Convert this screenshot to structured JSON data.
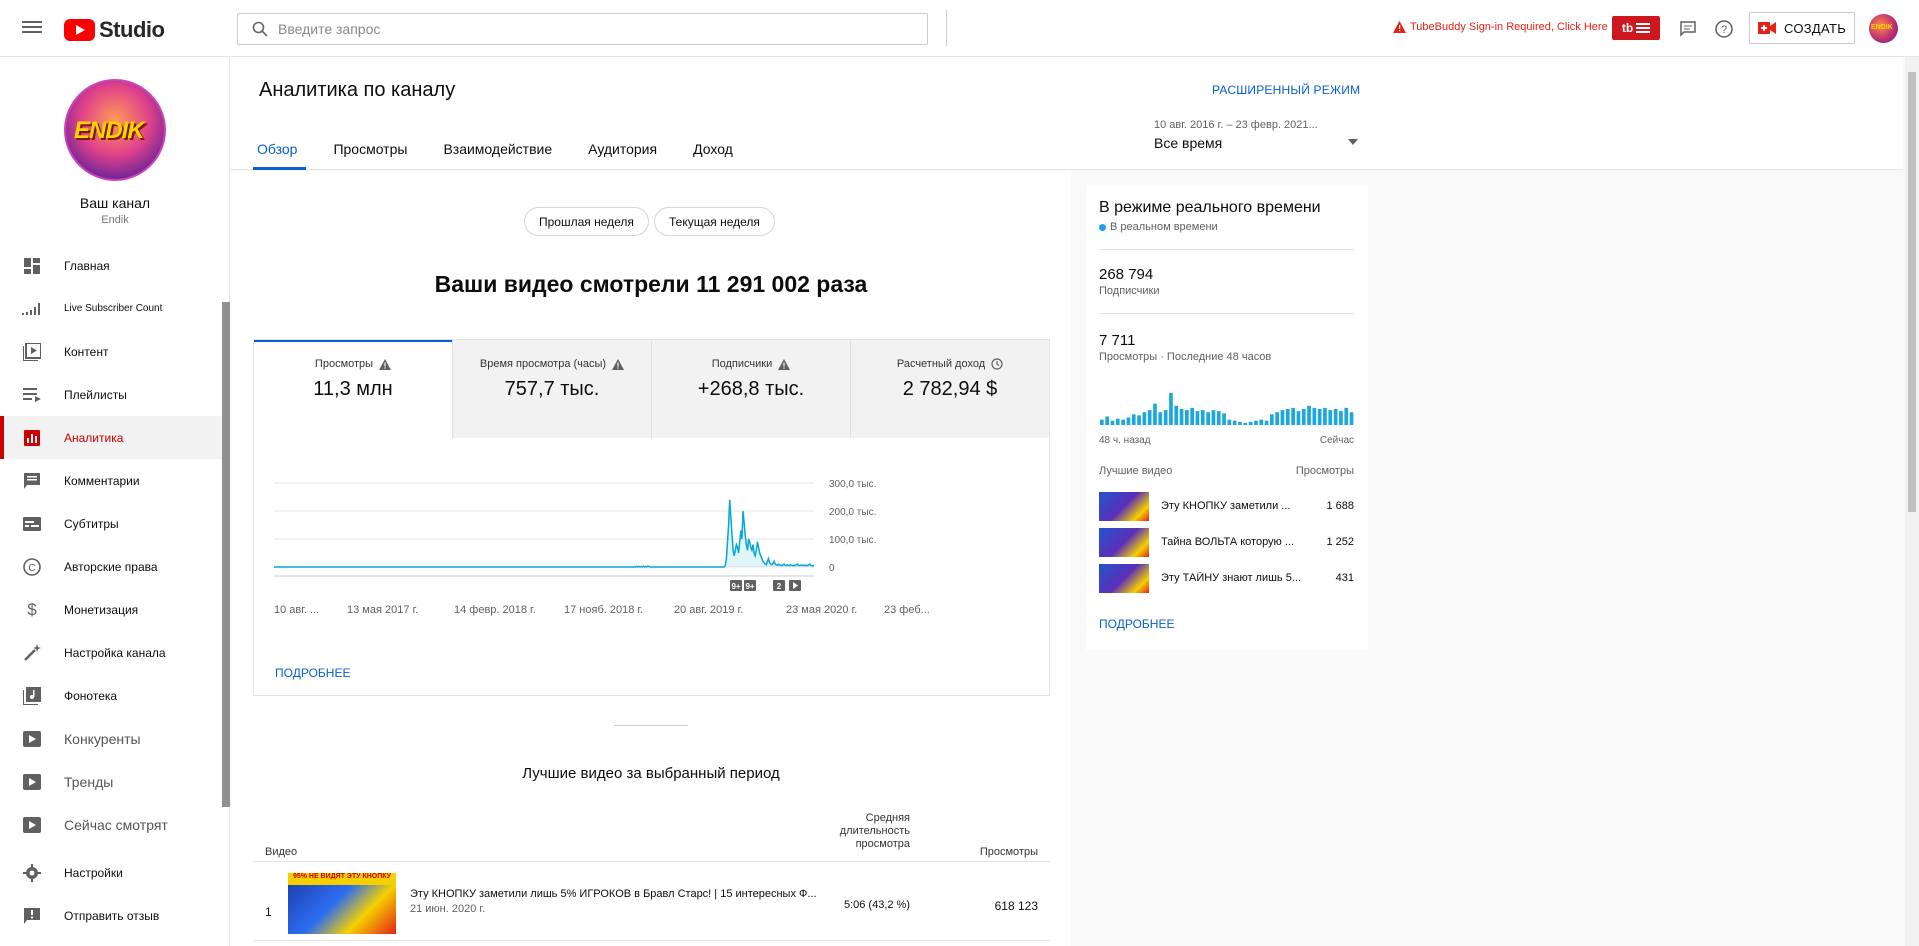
{
  "topbar": {
    "logo_text": "Studio",
    "search_placeholder": "Введите запрос",
    "tubebuddy_warning": "TubeBuddy Sign-in Required, Click Here",
    "tubebuddy_logo": "tb",
    "create_label": "СОЗДАТЬ"
  },
  "sidebar": {
    "channel_title": "Ваш канал",
    "channel_name": "Endik",
    "avatar_text": "ENDIK",
    "items": [
      {
        "label": "Главная",
        "icon": "dashboard-icon"
      },
      {
        "label": "Live Subscriber Count",
        "icon": "bar-signal-icon"
      },
      {
        "label": "Контент",
        "icon": "video-library-icon"
      },
      {
        "label": "Плейлисты",
        "icon": "playlist-icon"
      },
      {
        "label": "Аналитика",
        "icon": "analytics-icon"
      },
      {
        "label": "Комментарии",
        "icon": "comment-icon"
      },
      {
        "label": "Субтитры",
        "icon": "subtitles-icon"
      },
      {
        "label": "Авторские права",
        "icon": "copyright-icon"
      },
      {
        "label": "Монетизация",
        "icon": "dollar-icon"
      },
      {
        "label": "Настройка канала",
        "icon": "magic-wand-icon"
      },
      {
        "label": "Фонотека",
        "icon": "audio-library-icon"
      },
      {
        "label": "Конкуренты",
        "icon": "tubebuddy-play-icon"
      },
      {
        "label": "Тренды",
        "icon": "tubebuddy-play-icon"
      },
      {
        "label": "Сейчас смотрят",
        "icon": "tubebuddy-play-icon"
      },
      {
        "label": "Настройки",
        "icon": "gear-icon"
      },
      {
        "label": "Отправить отзыв",
        "icon": "feedback-icon"
      }
    ]
  },
  "header": {
    "title": "Аналитика по каналу",
    "advanced_mode": "РАСШИРЕННЫЙ РЕЖИМ",
    "tabs": [
      "Обзор",
      "Просмотры",
      "Взаимодействие",
      "Аудитория",
      "Доход"
    ],
    "active_tab": "Обзор",
    "period_range": "10 авг. 2016 г. – 23 февр. 2021...",
    "period_value": "Все время"
  },
  "overview": {
    "chips": [
      "Прошлая неделя",
      "Текущая неделя"
    ],
    "headline": "Ваши видео смотрели 11 291 002 раза",
    "metrics": [
      {
        "label": "Просмотры",
        "value": "11,3 млн",
        "icon": "warning-icon"
      },
      {
        "label": "Время просмотра (часы)",
        "value": "757,7 тыс.",
        "icon": "warning-icon"
      },
      {
        "label": "Подписчики",
        "value": "+268,8 тыс.",
        "icon": "warning-icon"
      },
      {
        "label": "Расчетный доход",
        "value": "2 782,94 $",
        "icon": "clock-icon"
      }
    ],
    "more_label": "ПОДРОБНЕЕ"
  },
  "chart_data": {
    "type": "line",
    "x_tick_labels": [
      "10 авг. ...",
      "13 мая 2017 г.",
      "14 февр. 2018 г.",
      "17 нояб. 2018 г.",
      "20 авг. 2019 г.",
      "23 мая 2020 г.",
      "23 феб..."
    ],
    "y_tick_labels": [
      "300,0 тыс.",
      "200,0 тыс.",
      "100,0 тыс.",
      "0"
    ],
    "ylim": [
      0,
      300000
    ],
    "series": [
      {
        "values": [
          0,
          0,
          0,
          0,
          0,
          0,
          0,
          0,
          0,
          0,
          0,
          0,
          0,
          0,
          0,
          0,
          0,
          0,
          0,
          0,
          0,
          0,
          0,
          0,
          0,
          0,
          0,
          0,
          0,
          0,
          0,
          0,
          0,
          0,
          0,
          0,
          0,
          0,
          0,
          0,
          0,
          0,
          0,
          0,
          0,
          0,
          0,
          0,
          0,
          0,
          0,
          0,
          0,
          0,
          0,
          0,
          0,
          0,
          0,
          0,
          0,
          0,
          0,
          0,
          0,
          0,
          0,
          0,
          0,
          0,
          0,
          0,
          0,
          0,
          0,
          0,
          0,
          0,
          0,
          0,
          0,
          0,
          0,
          0,
          0,
          0,
          0,
          0,
          0,
          0,
          0,
          0,
          0,
          0,
          0,
          0,
          0,
          0,
          0,
          0,
          0,
          0,
          0,
          0,
          0,
          0,
          0,
          0,
          0,
          0,
          0,
          0,
          0,
          0,
          0,
          0,
          0,
          0,
          0,
          0,
          0,
          0,
          0,
          0,
          0,
          0,
          0,
          0,
          0,
          0,
          0,
          0,
          0,
          0,
          0,
          0,
          0,
          0,
          0,
          0,
          0,
          0,
          0,
          0,
          0,
          0,
          0,
          0,
          0,
          0,
          0,
          0,
          0,
          0,
          0,
          0,
          0,
          0,
          0,
          0,
          0,
          0,
          0,
          0,
          0,
          0,
          0,
          0,
          0,
          0,
          0,
          0,
          0,
          0,
          0,
          0,
          0,
          0,
          0,
          0,
          0,
          0,
          0,
          0,
          0,
          0,
          0,
          0,
          0,
          0,
          0,
          0,
          0,
          0,
          0,
          0,
          0,
          0,
          0,
          0,
          0,
          0,
          0,
          0,
          0,
          0,
          0,
          0,
          0,
          0,
          0,
          0,
          0,
          0,
          0,
          0,
          0,
          0,
          0,
          0,
          0,
          0,
          0,
          0,
          0,
          0,
          0,
          0,
          0,
          0,
          0,
          0,
          0,
          0,
          0,
          0,
          0,
          0,
          0,
          0,
          0,
          0,
          0,
          0,
          0,
          0,
          0,
          0,
          0,
          0,
          0,
          0,
          0,
          0,
          0,
          0,
          0,
          0,
          0,
          0,
          0,
          0,
          0,
          0,
          0,
          0,
          0,
          0,
          0,
          0,
          0,
          0,
          0,
          0,
          0,
          0,
          0,
          0,
          0,
          0,
          0,
          0,
          0,
          0,
          0,
          0,
          0,
          0,
          0,
          0,
          0,
          0,
          0,
          0,
          0,
          0,
          0,
          0,
          0,
          0,
          0,
          0,
          0,
          0,
          0,
          0,
          0,
          0,
          0,
          0,
          0,
          0,
          0,
          0,
          0,
          0,
          0,
          0,
          0,
          0,
          0,
          0,
          0,
          0,
          0,
          0,
          0,
          2000,
          0,
          2000,
          0,
          1000,
          0,
          3000,
          0,
          2000,
          0,
          3000,
          2000,
          0,
          0,
          0,
          0,
          0,
          0,
          0,
          0,
          0,
          0,
          0,
          0,
          0,
          0,
          0,
          0,
          0,
          0,
          0,
          0,
          0,
          0,
          0,
          0,
          0,
          0,
          0,
          0,
          0,
          0,
          0,
          0,
          0,
          0,
          0,
          0,
          0,
          0,
          0,
          0,
          0,
          0,
          0,
          0,
          0,
          0,
          0,
          0,
          0,
          0,
          0,
          0,
          0,
          0,
          0,
          0,
          0,
          0,
          0,
          0,
          0,
          0,
          0,
          0,
          0,
          0,
          0,
          0,
          5000,
          30000,
          90000,
          150000,
          240000,
          180000,
          120000,
          60000,
          40000,
          60000,
          80000,
          70000,
          50000,
          90000,
          130000,
          100000,
          200000,
          160000,
          110000,
          80000,
          60000,
          100000,
          90000,
          70000,
          60000,
          80000,
          50000,
          40000,
          60000,
          90000,
          70000,
          50000,
          40000,
          30000,
          20000,
          15000,
          10000,
          8000,
          20000,
          30000,
          15000,
          10000,
          8000,
          12000,
          20000,
          10000,
          8000,
          6000,
          10000,
          8000,
          6000,
          5000,
          8000,
          10000,
          6000,
          5000,
          8000,
          6000,
          5000,
          8000,
          6000,
          5000,
          6000,
          5000,
          8000,
          10000,
          6000,
          5000,
          6000,
          8000,
          5000,
          6000,
          5000,
          6000,
          5000,
          8000,
          10000,
          6000,
          5000,
          4000,
          6000
        ]
      }
    ],
    "annotations": [
      "9+",
      "9+",
      "2",
      "play"
    ]
  },
  "best_videos": {
    "title": "Лучшие видео за выбранный период",
    "columns": [
      "Видео",
      "Средняя длительность просмотра",
      "Просмотры"
    ],
    "rows": [
      {
        "index": "1",
        "title": "Эту КНОПКУ заметили лишь 5% ИГРОКОВ в Бравл Старс! | 15 интересных Ф...",
        "date": "21 июн. 2020 г.",
        "avg_duration": "5:06  (43,2 %)",
        "views": "618 123",
        "thumb_tag": "95% НЕ ВИДЯТ ЭТУ КНОПКУ"
      }
    ]
  },
  "realtime": {
    "title": "В режиме реального времени",
    "live_label": "В реальном времени",
    "subscribers_value": "268 794",
    "subscribers_label": "Подписчики",
    "views_value": "7 711",
    "views_label": "Просмотры · Последние 48 часов",
    "axis_left": "48 ч. назад",
    "axis_right": "Сейчас",
    "bars": [
      5,
      8,
      4,
      6,
      5,
      7,
      10,
      9,
      12,
      14,
      20,
      12,
      14,
      30,
      18,
      15,
      14,
      16,
      13,
      14,
      12,
      14,
      13,
      11,
      5,
      4,
      3,
      2,
      3,
      4,
      5,
      4,
      10,
      12,
      14,
      15,
      16,
      13,
      15,
      18,
      16,
      15,
      16,
      14,
      15,
      13,
      16,
      12
    ],
    "top_videos_header": "Лучшие видео",
    "views_header": "Просмотры",
    "videos": [
      {
        "title": "Эту КНОПКУ заметили ...",
        "views": "1 688"
      },
      {
        "title": "Тайна ВОЛЬТА которую ...",
        "views": "1 252"
      },
      {
        "title": "Эту ТАЙНУ знают лишь 5...",
        "views": "431"
      }
    ],
    "more_label": "ПОДРОБНЕЕ"
  }
}
